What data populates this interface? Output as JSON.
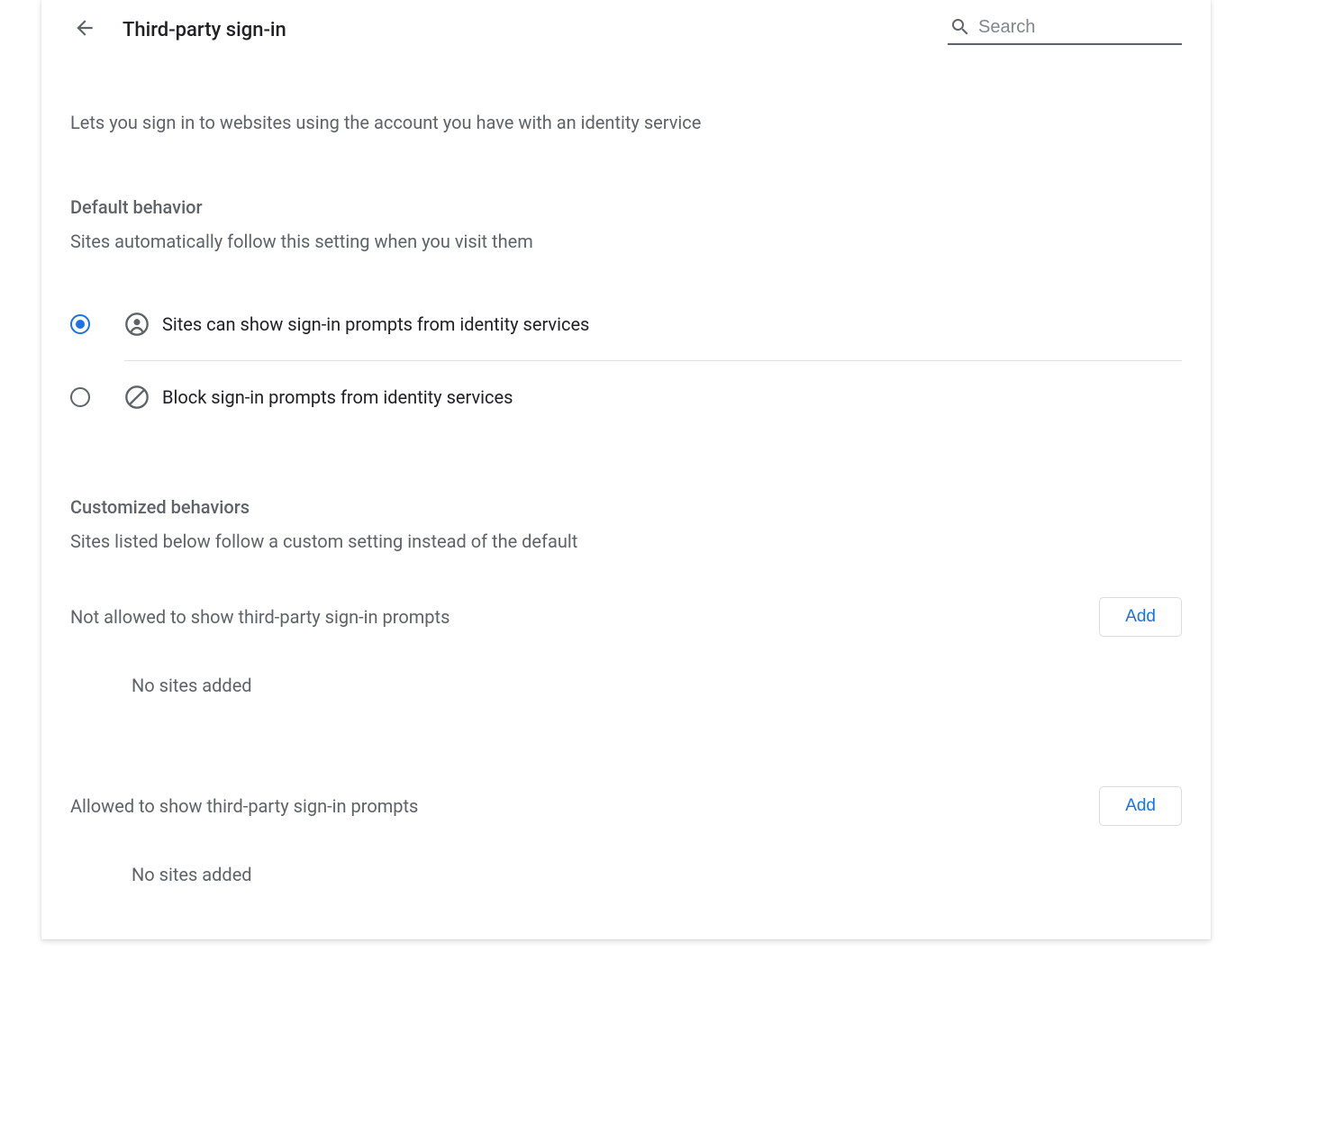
{
  "header": {
    "title": "Third-party sign-in",
    "search_placeholder": "Search"
  },
  "intro": "Lets you sign in to websites using the account you have with an identity service",
  "default_behavior": {
    "title": "Default behavior",
    "description": "Sites automatically follow this setting when you visit them",
    "options": [
      {
        "label": "Sites can show sign-in prompts from identity services",
        "checked": true
      },
      {
        "label": "Block sign-in prompts from identity services",
        "checked": false
      }
    ]
  },
  "customized": {
    "title": "Customized behaviors",
    "description": "Sites listed below follow a custom setting instead of the default",
    "sections": [
      {
        "label": "Not allowed to show third-party sign-in prompts",
        "add_label": "Add",
        "empty_text": "No sites added"
      },
      {
        "label": "Allowed to show third-party sign-in prompts",
        "add_label": "Add",
        "empty_text": "No sites added"
      }
    ]
  }
}
